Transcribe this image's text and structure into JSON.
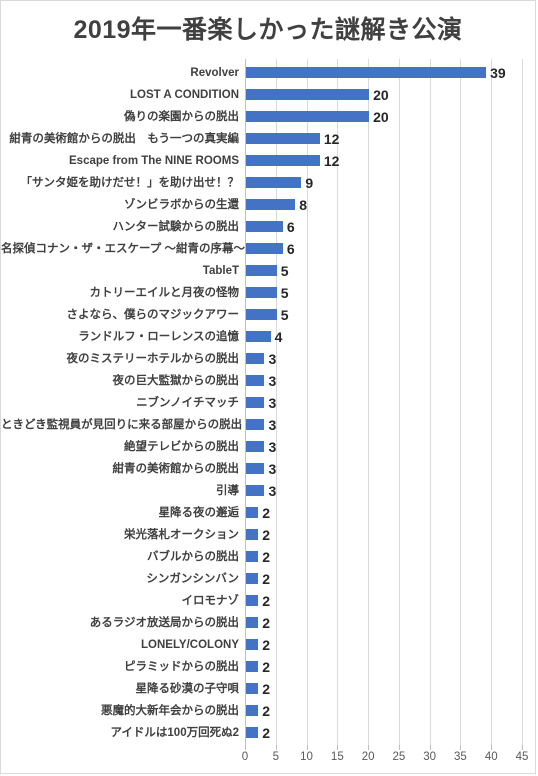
{
  "chart_data": {
    "type": "bar",
    "orientation": "horizontal",
    "title": "2019年一番楽しかった謎解き公演",
    "xlabel": "",
    "ylabel": "",
    "xlim": [
      0,
      45
    ],
    "xticks": [
      0,
      5,
      10,
      15,
      20,
      25,
      30,
      35,
      40,
      45
    ],
    "grid": true,
    "legend": false,
    "bar_color": "#4472C4",
    "title_color": "#404040",
    "categories": [
      "Revolver",
      "LOST A CONDITION",
      "偽りの楽園からの脱出",
      "紺青の美術館からの脱出　もう一つの真実編",
      "Escape from The NINE ROOMS",
      "「サンタ姫を助けだせ！」を助け出せ！？",
      "ゾンビラボからの生還",
      "ハンター試験からの脱出",
      "名探偵コナン・ザ・エスケープ ～紺青の序幕～",
      "TableT",
      "カトリーエイルと月夜の怪物",
      "さよなら、僕らのマジックアワー",
      "ランドルフ・ローレンスの追憶",
      "夜のミステリーホテルからの脱出",
      "夜の巨大監獄からの脱出",
      "ニブンノイチマッチ",
      "ときどき監視員が見回りに来る部屋からの脱出",
      "絶望テレビからの脱出",
      "紺青の美術館からの脱出",
      "引導",
      "星降る夜の邂逅",
      "栄光落札オークション",
      "バブルからの脱出",
      "シンガンシンバン",
      "イロモナゾ",
      "あるラジオ放送局からの脱出",
      "LONELY/COLONY",
      "ピラミッドからの脱出",
      "星降る砂漠の子守唄",
      "悪魔的大新年会からの脱出",
      "アイドルは100万回死ぬ2"
    ],
    "values": [
      39,
      20,
      20,
      12,
      12,
      9,
      8,
      6,
      6,
      5,
      5,
      5,
      4,
      3,
      3,
      3,
      3,
      3,
      3,
      3,
      2,
      2,
      2,
      2,
      2,
      2,
      2,
      2,
      2,
      2,
      2
    ]
  }
}
